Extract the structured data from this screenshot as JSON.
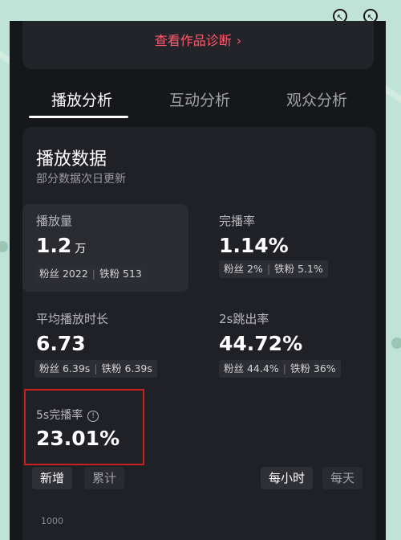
{
  "diagnosis_link": "查看作品诊断",
  "tabs": [
    "播放分析",
    "互动分析",
    "观众分析"
  ],
  "card": {
    "title": "播放数据",
    "subtitle": "部分数据次日更新"
  },
  "metrics": {
    "plays": {
      "label": "播放量",
      "value": "1.2",
      "unit": "万",
      "fan": "粉丝 2022",
      "iron": "铁粉 513"
    },
    "completion": {
      "label": "完播率",
      "value": "1.14%",
      "fan": "粉丝 2%",
      "iron": "铁粉 5.1%"
    },
    "avg_duration": {
      "label": "平均播放时长",
      "value": "6.73",
      "fan": "粉丝 6.39s",
      "iron": "铁粉 6.39s"
    },
    "bounce_2s": {
      "label": "2s跳出率",
      "value": "44.72%",
      "fan": "粉丝 44.4%",
      "iron": "铁粉 36%"
    },
    "completion_5s": {
      "label": "5s完播率",
      "value": "23.01%"
    }
  },
  "toggles": {
    "left": [
      "新增",
      "累计"
    ],
    "right": [
      "每小时",
      "每天"
    ]
  },
  "chart_axis_tick": "1000",
  "colors": {
    "accent": "#ff5a6e",
    "highlight_border": "#c9201f"
  }
}
